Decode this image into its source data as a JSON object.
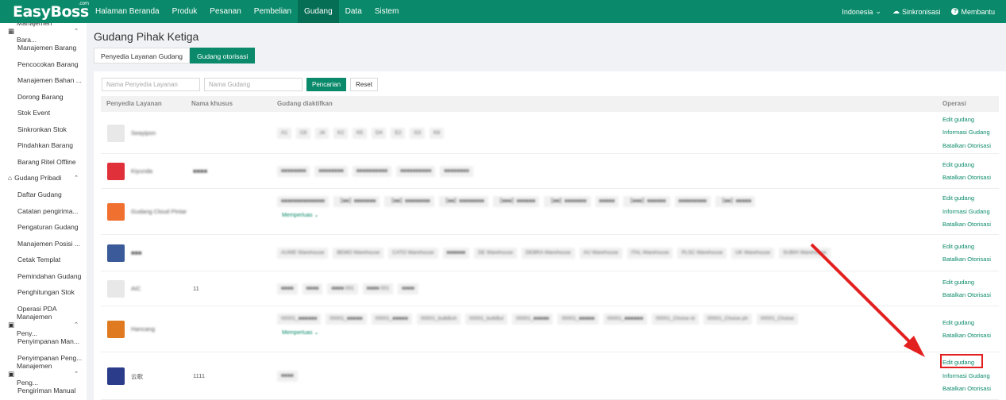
{
  "header": {
    "logo": "EasyBoss",
    "logo_sup": ".com",
    "nav": [
      "Halaman Beranda",
      "Produk",
      "Pesanan",
      "Pembelian",
      "Gudang",
      "Data",
      "Sistem"
    ],
    "active_nav": "Gudang",
    "language": "Indonesia",
    "sync": "Sinkronisasi",
    "help": "Membantu"
  },
  "sidebar": {
    "group1": "Manajemen Bara...",
    "group1_items": [
      "Manajemen Barang",
      "Pencocokan Barang",
      "Manajemen Bahan ...",
      "Dorong Barang",
      "Stok Event",
      "Sinkronkan Stok",
      "Pindahkan Barang",
      "Barang Ritel Offline"
    ],
    "group2": "Gudang Pribadi",
    "group2_items": [
      "Daftar Gudang",
      "Catatan pengirima...",
      "Pengaturan Gudang",
      "Manajemen Posisi ...",
      "Cetak Templat",
      "Pemindahan Gudang",
      "Penghitungan Stok",
      "Operasi PDA"
    ],
    "group3": "Manajemen Peny...",
    "group3_items": [
      "Penyimpanan Man...",
      "Penyimpanan Peng..."
    ],
    "group4": "Manajemen Peng...",
    "group4_items": [
      "Pengiriman Manual"
    ]
  },
  "page": {
    "title": "Gudang Pihak Ketiga",
    "tabs": [
      "Penyedia Layanan Gudang",
      "Gudang otorisasi"
    ],
    "active_tab": "Gudang otorisasi"
  },
  "filters": {
    "provider_placeholder": "Nama Penyedia Layanan",
    "warehouse_placeholder": "Nama Gudang",
    "search_label": "Pencarian",
    "reset_label": "Reset"
  },
  "table": {
    "headers": [
      "Penyedia Layanan",
      "Nama khusus",
      "Gudang diaktifkan",
      "Operasi"
    ],
    "more_label": "Memperluas",
    "rows": [
      {
        "provider": "Seayipon",
        "alias": "",
        "chips": [
          "A1",
          "C6",
          "J4",
          "K2",
          "K5",
          "D4",
          "E2",
          "G3",
          "K8"
        ],
        "more": false,
        "ops": [
          "Edit gudang",
          "Informasi Gudang",
          "Batalkan Otorisasi"
        ]
      },
      {
        "provider": "Kiyunda",
        "alias": "■■■■",
        "chips": [
          "■■■■■■■■",
          "■■■■■■■■",
          "■■■■■■■■■■",
          "■■■■■■■■■■",
          "■■■■■■■■"
        ],
        "more": false,
        "ops": [
          "Edit gudang",
          "Batalkan Otorisasi"
        ]
      },
      {
        "provider": "Gudang Cloud Pintar",
        "alias": "",
        "chips": [
          "■■■■■■■■■■■■■■",
          "【■■】■■■■■■■",
          "【■■】■■■■■■■■",
          "【■■】■■■■■■■■",
          "【■■■】■■■■■■",
          "【■■】■■■■■■■",
          "■■■■■",
          "【■■■】■■■■■■",
          "■■■■■■■■■",
          "【■■】■■■■■"
        ],
        "more": true,
        "ops": [
          "Edit gudang",
          "Informasi Gudang",
          "Batalkan Otorisasi"
        ]
      },
      {
        "provider": "■■■",
        "alias": "",
        "chips": [
          "AUWE Warehouse",
          "BEMO Warehouse",
          "CATO Warehouse",
          "■■■■■■",
          "DE Warehouse",
          "DEBRA Warehouse",
          "AU Warehouse",
          "ITAL Warehouse",
          "PLSC Warehouse",
          "UK Warehouse",
          "SUBIH Warehouse"
        ],
        "more": false,
        "ops": [
          "Edit gudang",
          "Batalkan Otorisasi"
        ]
      },
      {
        "provider": "AIC",
        "alias": "11",
        "chips": [
          "■■■■",
          "■■■■",
          "■■■■ 001",
          "■■■■ 001",
          "■■■■"
        ],
        "more": false,
        "ops": [
          "Edit gudang",
          "Batalkan Otorisasi"
        ]
      },
      {
        "provider": "Hancang",
        "alias": "",
        "chips": [
          "00001_■■■■■■",
          "00001_■■■■■",
          "00001_■■■■■",
          "00001_bulkBuh",
          "00001_bulkBul",
          "00001_■■■■■",
          "00001_■■■■■",
          "00001_■■■■■■",
          "00001_Choise id",
          "00001_Choise ph",
          "00001_Choise"
        ],
        "more": true,
        "ops": [
          "Edit gudang",
          "Batalkan Otorisasi"
        ]
      },
      {
        "provider": "云歌",
        "alias": "1111",
        "chips": [
          "■■■■"
        ],
        "more": false,
        "ops": [
          "Edit gudang",
          "Informasi Gudang",
          "Batalkan Otorisasi"
        ]
      }
    ]
  },
  "colors": {
    "brand": "#0a8a6a",
    "highlight": "#e32020"
  }
}
